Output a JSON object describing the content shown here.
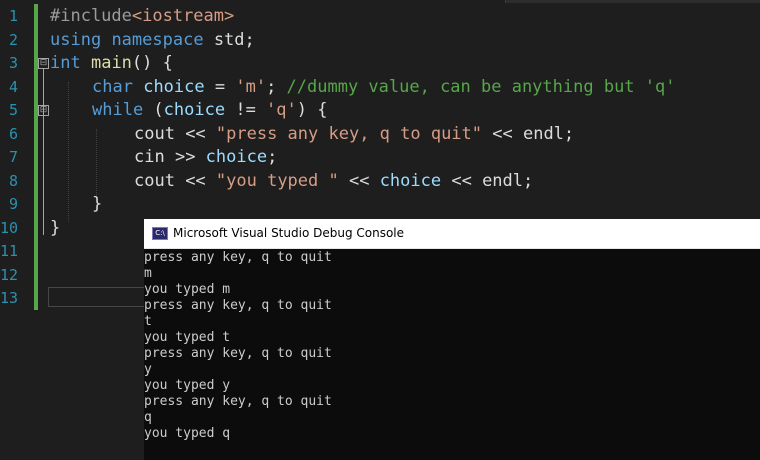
{
  "editor": {
    "line_numbers": [
      "1",
      "2",
      "3",
      "4",
      "5",
      "6",
      "7",
      "8",
      "9",
      "10",
      "11",
      "12",
      "13"
    ],
    "lines": {
      "l1": {
        "prefix": "#include",
        "lib": "<iostream>"
      },
      "l2": {
        "kw1": "using",
        "kw2": "namespace",
        "ident": "std",
        "semi": ";"
      },
      "l3": {
        "type": "int",
        "fn": "main",
        "rest": "() {"
      },
      "l4": {
        "type": "char",
        "var": "choice",
        "op": " = ",
        "lit": "'m'",
        "semi": "; ",
        "comment": "//dummy value, can be anything but 'q'"
      },
      "l5": {
        "kw": "while",
        "open": " (",
        "var": "choice",
        "op": " != ",
        "lit": "'q'",
        "close": ") {"
      },
      "l6": {
        "ident": "cout",
        "op1": " << ",
        "str": "\"press any key, q to quit\"",
        "op2": " << ",
        "end": "endl",
        "semi": ";"
      },
      "l7": {
        "ident": "cin",
        "op": " >> ",
        "var": "choice",
        "semi": ";"
      },
      "l8": {
        "ident": "cout",
        "op1": " << ",
        "str": "\"you typed \"",
        "op2": " << ",
        "var": "choice",
        "op3": " << ",
        "end": "endl",
        "semi": ";"
      },
      "l9": {
        "brace": "}"
      },
      "l10": {
        "brace": "}"
      }
    },
    "fold_markers": [
      "⊟",
      "⊟"
    ]
  },
  "console": {
    "title": "Microsoft Visual Studio Debug Console",
    "icon_label": "C:\\",
    "output": [
      "press any key, q to quit",
      "m",
      "you typed m",
      "press any key, q to quit",
      "t",
      "you typed t",
      "press any key, q to quit",
      "y",
      "you typed y",
      "press any key, q to quit",
      "q",
      "you typed q"
    ]
  },
  "colors": {
    "editor_background": "#1e1e1e",
    "line_number": "#2b91af",
    "keyword": "#569cd6",
    "string": "#d69d85",
    "comment": "#57a64a",
    "variable": "#9cdcfe",
    "function": "#dcdcaa",
    "console_background": "#0c0c0c",
    "console_text": "#cccccc"
  }
}
